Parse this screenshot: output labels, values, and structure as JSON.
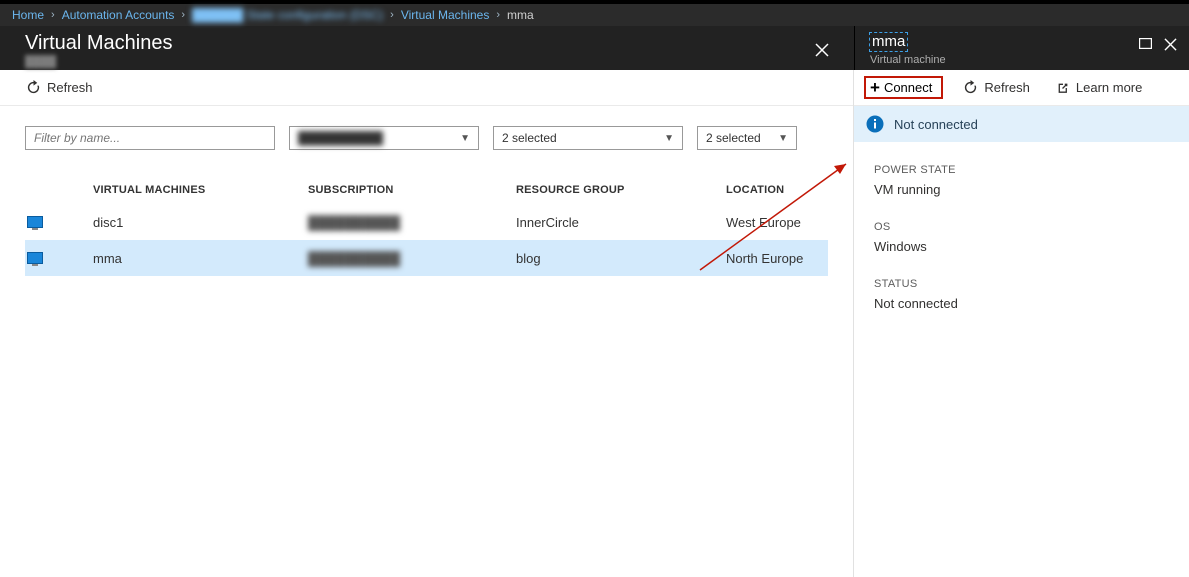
{
  "breadcrumb": {
    "items": [
      {
        "label": "Home"
      },
      {
        "label": "Automation Accounts"
      },
      {
        "label": "██████ State configuration (DSC)",
        "obscured": true
      },
      {
        "label": "Virtual Machines"
      },
      {
        "label": "mma",
        "last": true
      }
    ]
  },
  "left": {
    "title": "Virtual Machines",
    "subtitle": "████",
    "refresh_label": "Refresh",
    "filters": {
      "name_placeholder": "Filter by name...",
      "subscription_selected": "██████████",
      "rg_selected": "2 selected",
      "loc_selected": "2 selected"
    },
    "columns": {
      "vm": "VIRTUAL MACHINES",
      "sub": "SUBSCRIPTION",
      "rg": "RESOURCE GROUP",
      "loc": "LOCATION"
    },
    "rows": [
      {
        "name": "disc1",
        "subscription": "██████████",
        "resource_group": "InnerCircle",
        "location": "West Europe",
        "selected": false
      },
      {
        "name": "mma",
        "subscription": "██████████",
        "resource_group": "blog",
        "location": "North Europe",
        "selected": true
      }
    ]
  },
  "right": {
    "title": "mma",
    "subtitle": "Virtual machine",
    "connect_label": "Connect",
    "refresh_label": "Refresh",
    "learn_label": "Learn more",
    "status_banner": "Not connected",
    "props": {
      "power_state_label": "POWER STATE",
      "power_state_value": "VM running",
      "os_label": "OS",
      "os_value": "Windows",
      "status_label": "STATUS",
      "status_value": "Not connected"
    }
  }
}
